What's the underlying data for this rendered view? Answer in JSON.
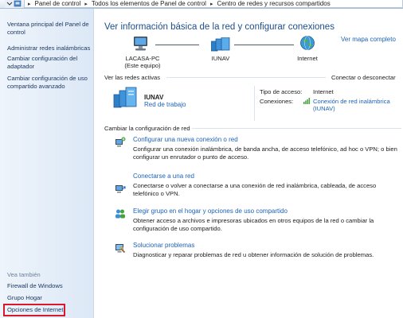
{
  "address": {
    "crumbs": [
      "Panel de control",
      "Todos los elementos de Panel de control",
      "Centro de redes y recursos compartidos"
    ]
  },
  "sidebar": {
    "links": [
      "Ventana principal del Panel de control",
      "Administrar redes inalámbricas",
      "Cambiar configuración del adaptador",
      "Cambiar configuración de uso compartido avanzado"
    ],
    "see_also_heading": "Vea también",
    "see_also": [
      "Firewall de Windows",
      "Grupo Hogar",
      "Opciones de Internet"
    ]
  },
  "main": {
    "title": "Ver información básica de la red y configurar conexiones",
    "map_link": "Ver mapa completo",
    "map": {
      "computer_name": "LACASA-PC",
      "computer_sub": "(Este equipo)",
      "network": "IUNAV",
      "internet": "Internet"
    },
    "active_networks_label": "Ver las redes activas",
    "connect_link": "Conectar o desconectar",
    "active_network": {
      "name": "IUNAV",
      "type": "Red de trabajo",
      "access_type_label": "Tipo de acceso:",
      "access_type_value": "Internet",
      "connections_label": "Conexiones:",
      "connection_value": "Conexión de red inalámbrica (IUNAV)"
    },
    "change_settings_label": "Cambiar la configuración de red",
    "tasks": [
      {
        "title": "Configurar una nueva conexión o red",
        "desc": "Configurar una conexión inalámbrica, de banda ancha, de acceso telefónico, ad hoc o VPN; o bien configurar un enrutador o punto de acceso."
      },
      {
        "title": "Conectarse a una red",
        "desc": "Conectarse o volver a conectarse a una conexión de red inalámbrica, cableada, de acceso telefónico o VPN."
      },
      {
        "title": "Elegir grupo en el hogar y opciones de uso compartido",
        "desc": "Obtener acceso a archivos e impresoras ubicados en otros equipos de la red o cambiar la configuración de uso compartido."
      },
      {
        "title": "Solucionar problemas",
        "desc": "Diagnosticar y reparar problemas de red u obtener información de solución de problemas."
      }
    ]
  },
  "colors": {
    "link": "#1d62b6",
    "title": "#1e4d8c",
    "highlight": "#d8182b"
  }
}
